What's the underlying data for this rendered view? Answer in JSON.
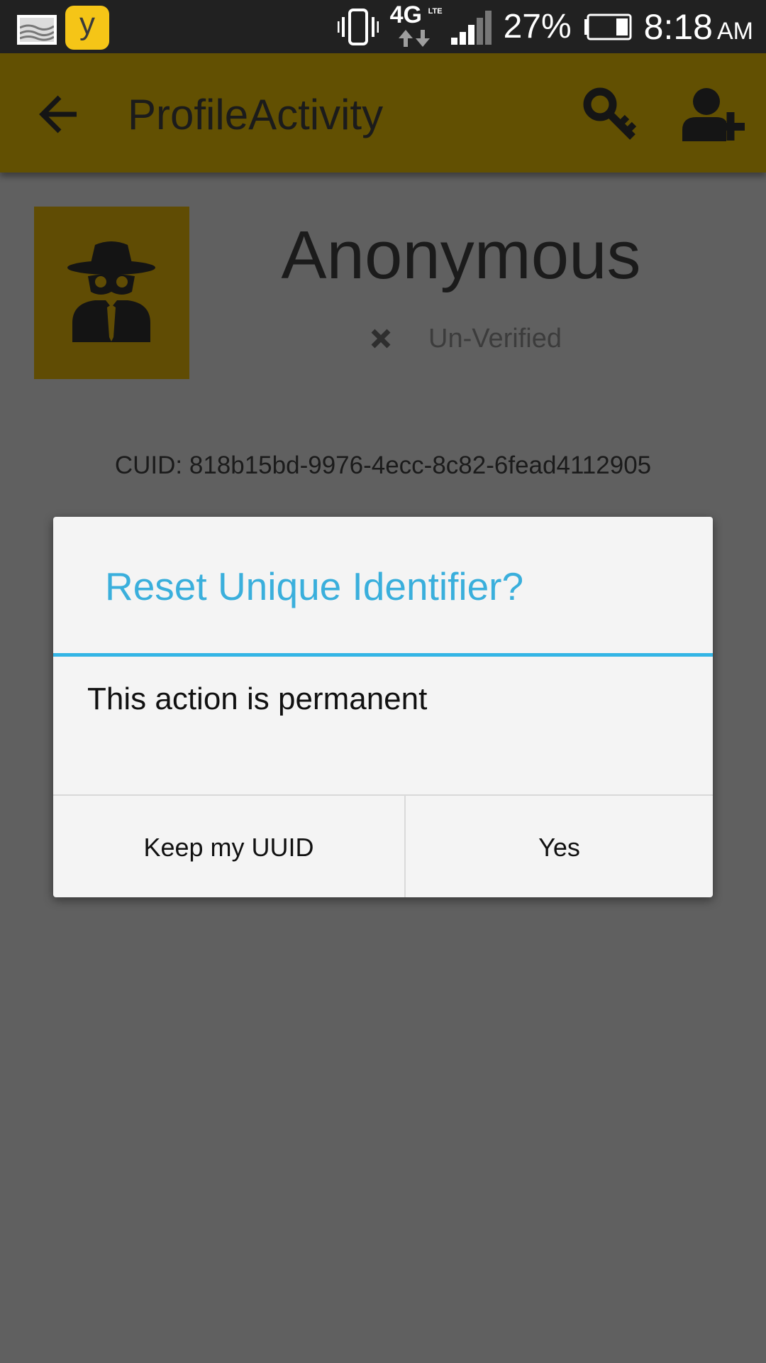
{
  "status_bar": {
    "network": "4G",
    "network_sub": "LTE",
    "battery_percent": "27%",
    "time": "8:18",
    "ampm": "AM",
    "notification_app_letter": "y",
    "icons": [
      "gallery-icon",
      "app-notification-icon",
      "vibrate-icon",
      "signal-icon",
      "battery-icon"
    ]
  },
  "app_bar": {
    "title": "ProfileActivity",
    "icons": [
      "back-arrow-icon",
      "key-icon",
      "add-user-icon"
    ]
  },
  "profile": {
    "name": "Anonymous",
    "verification_status": "Un-Verified",
    "cuid": "CUID: 818b15bd-9976-4ecc-8c82-6fead4112905",
    "avatar_icon": "spy-icon"
  },
  "dialog": {
    "title": "Reset Unique Identifier?",
    "message": "This action is permanent",
    "negative_label": "Keep my UUID",
    "positive_label": "Yes"
  },
  "colors": {
    "status_bar": "#212121",
    "app_bar": "#625002",
    "avatar_bg": "#604c04",
    "scrim_bg": "#606060",
    "dialog_bg": "#f4f4f4",
    "dialog_accent": "#33b5e5"
  }
}
